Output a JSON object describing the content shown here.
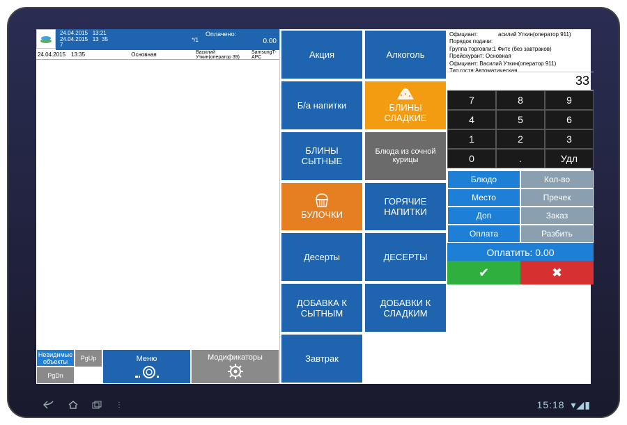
{
  "header": {
    "datetime_lines": "24.04.2015   13:21\n24.04.2015   13  35\n7",
    "datetime_right": "*/1",
    "paid_label": "Оплачено:",
    "paid_value": "0.00"
  },
  "columns": {
    "date": "24.04.2015",
    "time": "13:35",
    "group": "Основная",
    "operator": "Василий Уткин(оператор 39)",
    "device": "SamsungT-APC"
  },
  "left_bottom": {
    "invisible": "Невидимые объекты",
    "pgup": "PgUp",
    "pgdn": "PgDn",
    "menu": "Меню",
    "modifiers": "Модификаторы"
  },
  "categories": [
    {
      "label": "Акция",
      "style": "blue"
    },
    {
      "label": "Алкоголь",
      "style": "blue"
    },
    {
      "label": "Б/а напитки",
      "style": "blue"
    },
    {
      "label": "БЛИНЫ СЛАДКИЕ",
      "style": "orange",
      "icon": "cake"
    },
    {
      "label": "БЛИНЫ СЫТНЫЕ",
      "style": "blue"
    },
    {
      "label": "Блюда из сочной курицы",
      "style": "grey"
    },
    {
      "label": "БУЛОЧКИ",
      "style": "orange2",
      "icon": "muffin"
    },
    {
      "label": "ГОРЯЧИЕ НАПИТКИ",
      "style": "blue"
    },
    {
      "label": "Десерты",
      "style": "blue"
    },
    {
      "label": "ДЕСЕРТЫ",
      "style": "blue"
    },
    {
      "label": "ДОБАВКА К СЫТНЫМ",
      "style": "blue"
    },
    {
      "label": "ДОБАВКИ К СЛАДКИМ",
      "style": "blue"
    },
    {
      "label": "Завтрак",
      "style": "blue"
    }
  ],
  "info": {
    "officiant_lbl": "Официант:",
    "officiant_val": "асилий Уткин(оператор 911)",
    "l2": "Порядок подачи:",
    "l3": "Группа торговли:1 Фитс (без завтраков)",
    "l4": "Прейскурант: Основная",
    "l5": "Официант: Василий Уткин(оператор 911)",
    "l6": "Тип гостя:Автоматическая"
  },
  "qty_display": "33",
  "keypad": [
    "7",
    "8",
    "9",
    "4",
    "5",
    "6",
    "1",
    "2",
    "3",
    "0",
    ".",
    "Удл"
  ],
  "actions": {
    "dish": "Блюдо",
    "qty": "Кол-во",
    "place": "Место",
    "precheck": "Пречек",
    "add": "Доп",
    "order": "Заказ",
    "pay": "Оплата",
    "split": "Разбить",
    "pay_total": "Оплатить: 0.00"
  },
  "android": {
    "time": "15:18"
  }
}
